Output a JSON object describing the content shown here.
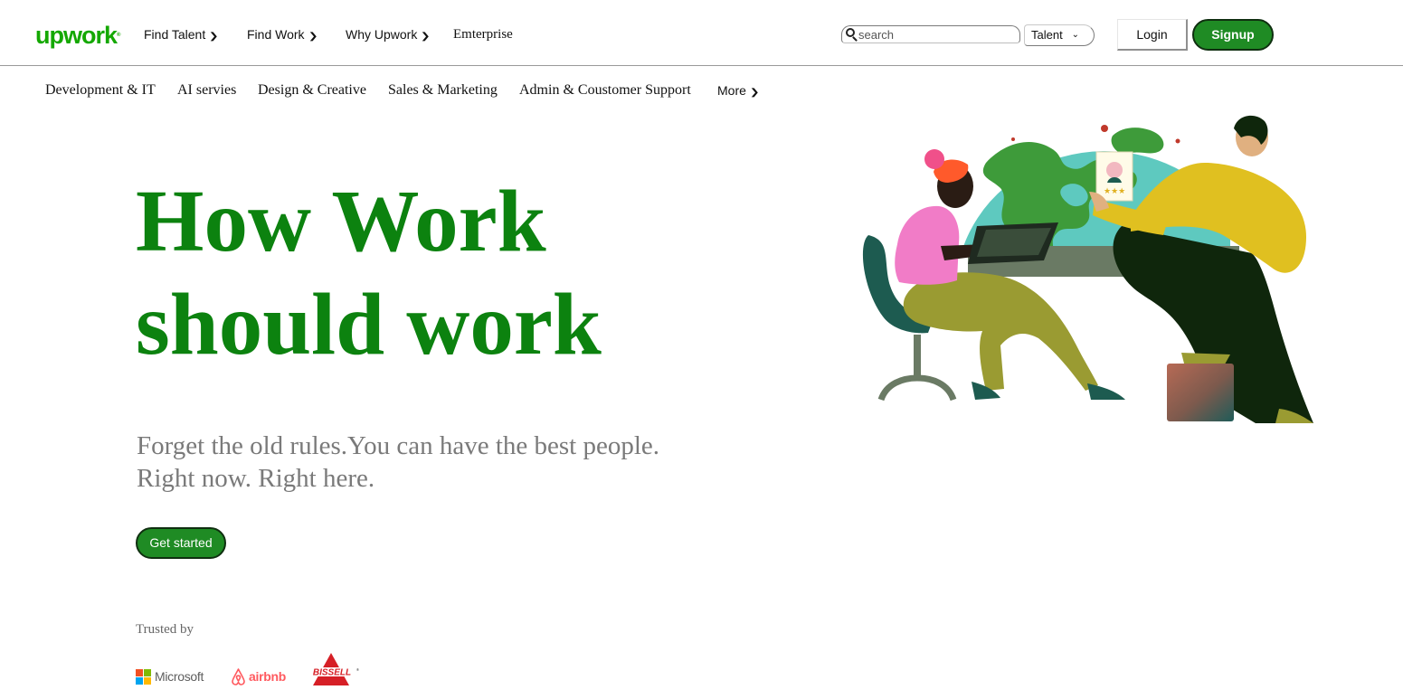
{
  "header": {
    "logo": "upwork",
    "logo_mark": "®",
    "nav": [
      {
        "label": "Find Talent",
        "dropdown": true
      },
      {
        "label": "Find Work",
        "dropdown": true
      },
      {
        "label": "Why Upwork",
        "dropdown": true
      },
      {
        "label": "Emterprise",
        "dropdown": false
      }
    ],
    "search_placeholder": "search",
    "search_icon": "search-icon",
    "select_value": "Talent",
    "login_label": "Login",
    "signup_label": "Signup"
  },
  "categories": [
    "Development & IT",
    "AI servies",
    "Design & Creative",
    "Sales & Marketing",
    "Admin & Coustomer Support",
    "More"
  ],
  "hero": {
    "title_line1": "How Work",
    "title_line2": "should work",
    "subtitle_line1": "Forget the old rules.You can have the best people.",
    "subtitle_line2": "Right now. Right here.",
    "cta_label": "Get started"
  },
  "trusted": {
    "label": "Trusted by",
    "brands": [
      "Microsoft",
      "airbnb",
      "BISSELL"
    ]
  },
  "colors": {
    "brand_green": "#14a800",
    "button_green": "#1f8b24",
    "hero_green": "#0c820f",
    "subtitle_gray": "#7a7a7a"
  }
}
